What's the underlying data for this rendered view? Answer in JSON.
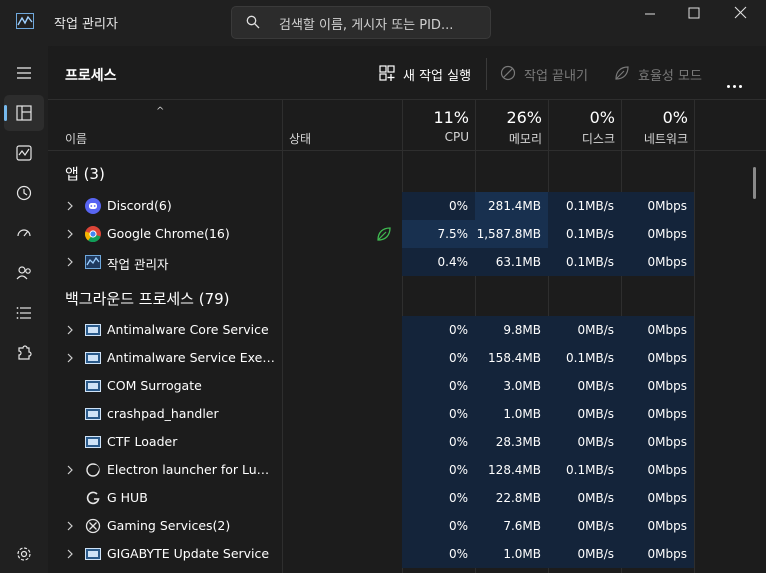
{
  "window": {
    "title": "작업 관리자",
    "search_placeholder": "검색할 이름, 게시자 또는 PID..."
  },
  "nav": {
    "items": [
      "processes-icon",
      "performance-icon",
      "app-history-icon",
      "startup-apps-icon",
      "users-icon",
      "details-icon",
      "services-icon"
    ],
    "active": "processes-icon",
    "bottom": "settings-icon"
  },
  "toolbar": {
    "title": "프로세스",
    "new_task": "새 작업 실행",
    "end_task": "작업 끝내기",
    "efficiency": "효율성 모드"
  },
  "columns": {
    "name": "이름",
    "status": "상태",
    "cpu_pct": "11%",
    "cpu": "CPU",
    "mem_pct": "26%",
    "mem": "메모리",
    "disk_pct": "0%",
    "disk": "디스크",
    "net_pct": "0%",
    "net": "네트워크"
  },
  "groups": {
    "apps": "앱 (3)",
    "background": "백그라운드 프로세스 (79)"
  },
  "apps": [
    {
      "name": "Discord(6)",
      "cpu": "0%",
      "mem": "281.4MB",
      "disk": "0.1MB/s",
      "net": "0Mbps"
    },
    {
      "name": "Google Chrome(16)",
      "cpu": "7.5%",
      "mem": "1,587.8MB",
      "disk": "0.1MB/s",
      "net": "0Mbps"
    },
    {
      "name": "작업 관리자",
      "cpu": "0.4%",
      "mem": "63.1MB",
      "disk": "0.1MB/s",
      "net": "0Mbps"
    }
  ],
  "background": [
    {
      "name": "Antimalware Core Service",
      "cpu": "0%",
      "mem": "9.8MB",
      "disk": "0MB/s",
      "net": "0Mbps"
    },
    {
      "name": "Antimalware Service Executa...",
      "cpu": "0%",
      "mem": "158.4MB",
      "disk": "0.1MB/s",
      "net": "0Mbps"
    },
    {
      "name": "COM Surrogate",
      "cpu": "0%",
      "mem": "3.0MB",
      "disk": "0MB/s",
      "net": "0Mbps"
    },
    {
      "name": "crashpad_handler",
      "cpu": "0%",
      "mem": "1.0MB",
      "disk": "0MB/s",
      "net": "0Mbps"
    },
    {
      "name": "CTF Loader",
      "cpu": "0%",
      "mem": "28.3MB",
      "disk": "0MB/s",
      "net": "0Mbps"
    },
    {
      "name": "Electron launcher for Lunar C...",
      "cpu": "0%",
      "mem": "128.4MB",
      "disk": "0.1MB/s",
      "net": "0Mbps"
    },
    {
      "name": "G HUB",
      "cpu": "0%",
      "mem": "22.8MB",
      "disk": "0MB/s",
      "net": "0Mbps"
    },
    {
      "name": "Gaming Services(2)",
      "cpu": "0%",
      "mem": "7.6MB",
      "disk": "0MB/s",
      "net": "0Mbps"
    },
    {
      "name": "GIGABYTE Update Service",
      "cpu": "0%",
      "mem": "1.0MB",
      "disk": "0MB/s",
      "net": "0Mbps"
    }
  ],
  "colors": {
    "accent": "#76b9ed",
    "heat_low": "#14243a",
    "heat_high": "#18304f"
  }
}
